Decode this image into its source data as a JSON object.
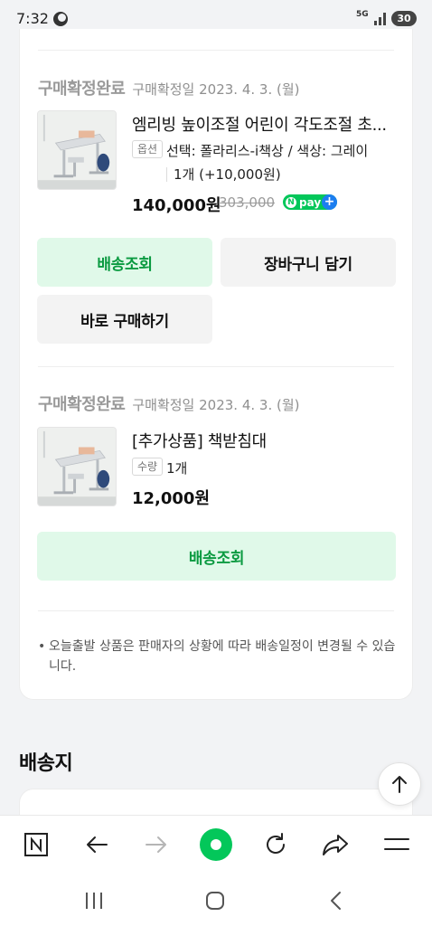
{
  "status_bar": {
    "time": "7:32",
    "network": "5G",
    "battery": "30"
  },
  "orders": [
    {
      "status": "구매확정완료",
      "confirm_date": "구매확정일 2023. 4. 3. (월)",
      "name": "엠리빙 높이조절 어린이 각도조절 초...",
      "option_tag": "옵션",
      "option_line1": "선택: 폴라리스-i책상 / 색상: 그레이",
      "option_line2": "1개 (+10,000원)",
      "price": "140,000원",
      "original_price": "303,000",
      "npay_label": "pay",
      "buttons": {
        "track": "배송조회",
        "cart": "장바구니 담기",
        "buy": "바로 구매하기"
      }
    },
    {
      "status": "구매확정완료",
      "confirm_date": "구매확정일 2023. 4. 3. (월)",
      "name": "[추가상품] 책받침대",
      "qty_tag": "수량",
      "qty": "1개",
      "price": "12,000원",
      "buttons": {
        "track": "배송조회"
      }
    }
  ],
  "notice": "오늘출발 상품은 판매자의 상황에 따라 배송일정이 변경될 수 있습니다.",
  "shipping_section": {
    "title": "배송지"
  },
  "icons": {
    "browser": [
      "naver-home-icon",
      "back-arrow-icon",
      "forward-arrow-icon",
      "green-dot-icon",
      "refresh-icon",
      "share-icon",
      "menu-icon"
    ],
    "nav": [
      "recent-apps-icon",
      "home-icon",
      "back-icon"
    ],
    "scroll_top": "arrow-up-icon"
  },
  "colors": {
    "accent_green": "#03c75a",
    "button_green_bg": "#e0f9e9",
    "button_green_text": "#0a9a40"
  }
}
